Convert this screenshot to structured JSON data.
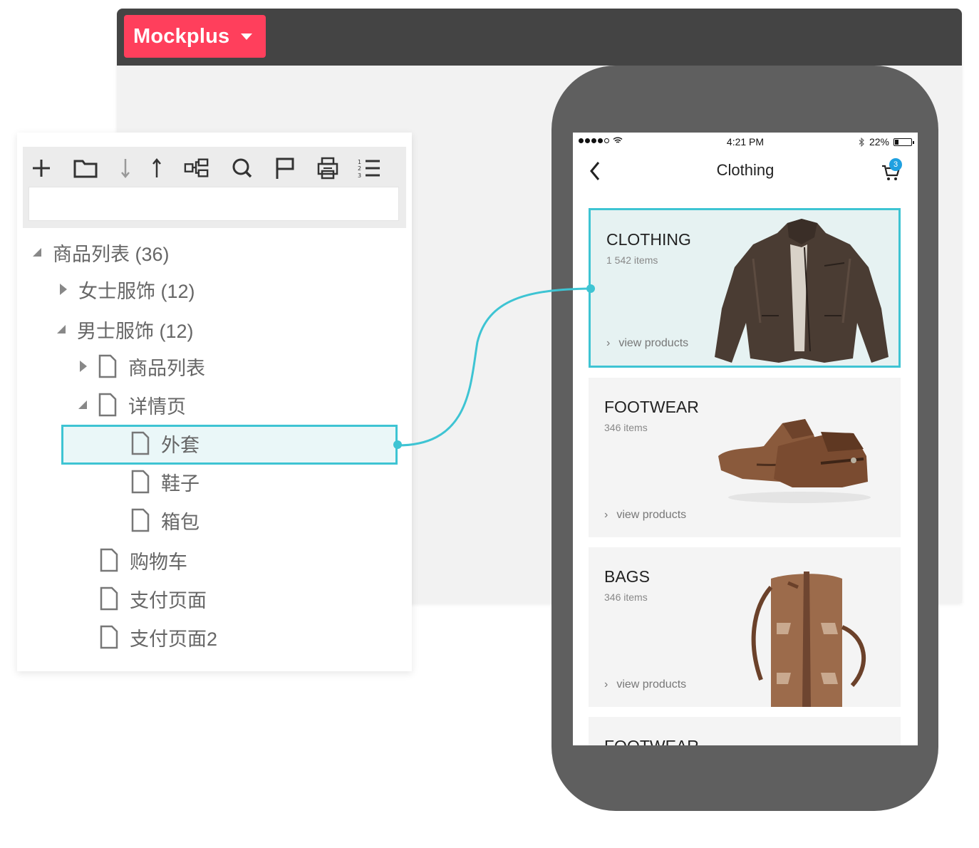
{
  "app": {
    "brand": "Mockplus"
  },
  "tree": {
    "search_value": "",
    "toolbar": [
      "add-icon",
      "folder-icon",
      "move-down-icon",
      "move-up-icon",
      "hierarchy-icon",
      "search-icon",
      "flag-icon",
      "export-icon",
      "numbered-list-icon"
    ],
    "items": [
      {
        "label": "商品列表 (36)",
        "expanded": true
      },
      {
        "label": "女士服饰 (12)",
        "expanded": false
      },
      {
        "label": "男士服饰 (12)",
        "expanded": true
      },
      {
        "label": "商品列表"
      },
      {
        "label": "详情页",
        "expanded": true
      },
      {
        "label": "外套",
        "selected": true
      },
      {
        "label": "鞋子"
      },
      {
        "label": "箱包"
      },
      {
        "label": "购物车"
      },
      {
        "label": "支付页面"
      },
      {
        "label": "支付页面2"
      }
    ]
  },
  "phone": {
    "status": {
      "time": "4:21 PM",
      "battery": "22%",
      "battery_level": 0.22
    },
    "nav": {
      "title": "Clothing",
      "cart_count": "3"
    },
    "cards": [
      {
        "title": "CLOTHING",
        "count": "1 542 items",
        "link": "view products",
        "selected": true
      },
      {
        "title": "FOOTWEAR",
        "count": "346 items",
        "link": "view products"
      },
      {
        "title": "BAGS",
        "count": "346 items",
        "link": "view products"
      },
      {
        "title": "FOOTWEAR"
      }
    ]
  },
  "colors": {
    "brand": "#ff3f5c",
    "accent": "#3ec4d3",
    "titlebar": "#444444",
    "phone_body": "#5f5f5f",
    "badge": "#1fa0e0"
  }
}
